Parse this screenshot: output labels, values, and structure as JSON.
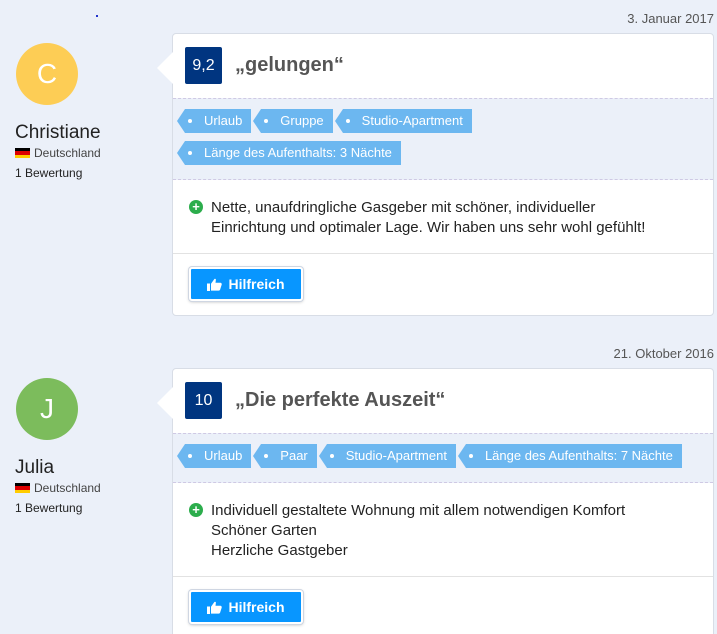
{
  "colors": {
    "page_bg": "#ebf0f9",
    "score_bg": "#003580",
    "tag_bg": "#6cb7f0",
    "button_bg": "#0896ff",
    "plus_green": "#2cad4c"
  },
  "reviews": [
    {
      "date": "3. Januar 2017",
      "avatar_letter": "C",
      "avatar_color": "#fdcd55",
      "name": "Christiane",
      "country": "Deutschland",
      "review_count": "1 Bewertung",
      "score": "9,2",
      "title": "„gelungen“",
      "tags": [
        "Urlaub",
        "Gruppe",
        "Studio-Apartment",
        "Länge des Aufenthalts: 3 Nächte"
      ],
      "positive_lines": [
        "Nette, unaufdringliche Gasgeber mit schöner, individueller",
        "Einrichtung und optimaler Lage. Wir haben uns sehr wohl gefühlt!"
      ],
      "helpful_label": "Hilfreich",
      "helpful_icon": "thumbs-up-icon"
    },
    {
      "date": "21. Oktober 2016",
      "avatar_letter": "J",
      "avatar_color": "#7cbc5c",
      "name": "Julia",
      "country": "Deutschland",
      "review_count": "1 Bewertung",
      "score": "10",
      "title": "„Die perfekte Auszeit“",
      "tags": [
        "Urlaub",
        "Paar",
        "Studio-Apartment",
        "Länge des Aufenthalts: 7 Nächte"
      ],
      "positive_lines": [
        "Individuell gestaltete Wohnung mit allem notwendigen Komfort",
        "Schöner Garten",
        "Herzliche Gastgeber"
      ],
      "helpful_label": "Hilfreich",
      "helpful_icon": "thumbs-up-icon"
    }
  ]
}
